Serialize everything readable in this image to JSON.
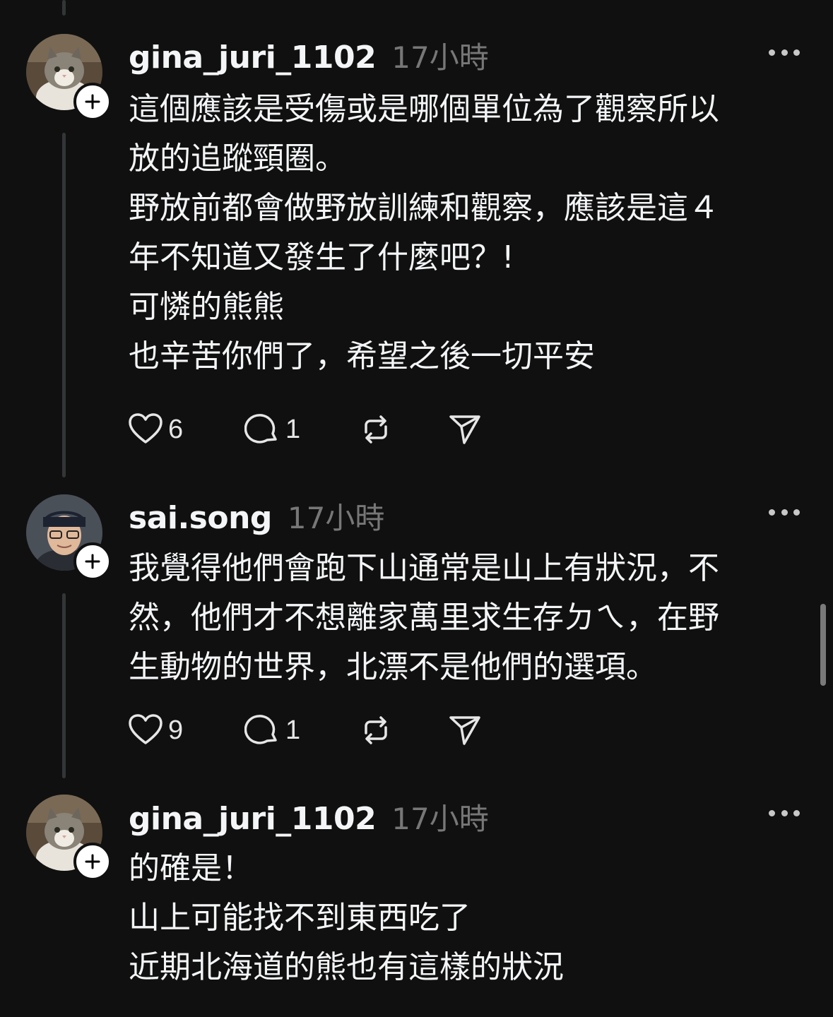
{
  "comments": [
    {
      "username": "gina_juri_1102",
      "time": "17小時",
      "avatar_icon": "cat-avatar-icon",
      "lines": [
        "這個應該是受傷或是哪個單位為了觀察所以",
        "放的追蹤頸圈。",
        "野放前都會做野放訓練和觀察，應該是這４",
        "年不知道又發生了什麼吧？!",
        "可憐的熊熊",
        "也辛苦你們了，希望之後一切平安"
      ],
      "likes": "6",
      "replies": "1"
    },
    {
      "username": "sai.song",
      "time": "17小時",
      "avatar_icon": "person-avatar-icon",
      "lines": [
        "我覺得他們會跑下山通常是山上有狀況，不",
        "然，他們才不想離家萬里求生存ㄉㄟ，在野",
        "生動物的世界，北漂不是他們的選項。"
      ],
      "likes": "9",
      "replies": "1"
    },
    {
      "username": "gina_juri_1102",
      "time": "17小時",
      "avatar_icon": "cat-avatar-icon",
      "lines": [
        "的確是！",
        "山上可能找不到東西吃了",
        "近期北海道的熊也有這樣的狀況"
      ]
    }
  ],
  "colors": {
    "background": "#101010",
    "text": "#f3f5f7",
    "muted": "#777777",
    "thread_line": "#333638"
  }
}
